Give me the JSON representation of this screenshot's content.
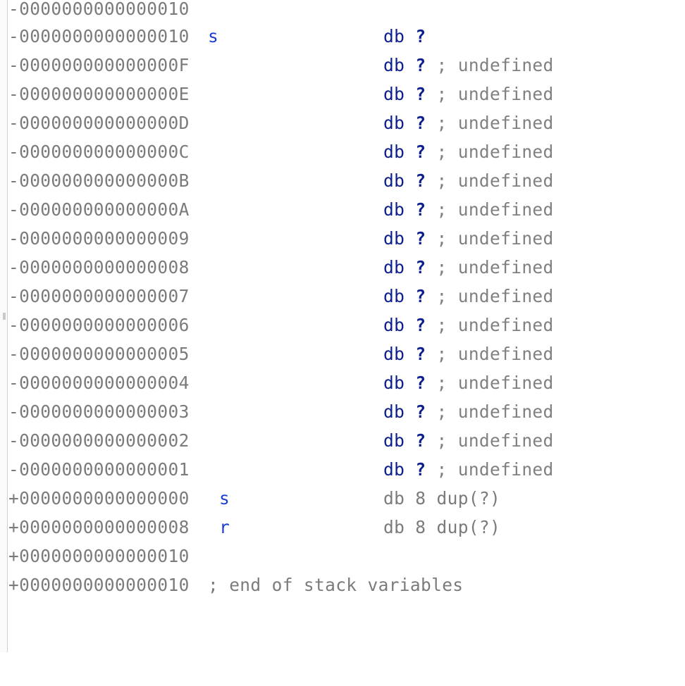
{
  "stack_frame": {
    "lines": [
      {
        "address": "-0000000000000010",
        "name": "",
        "directive": "",
        "operand": "",
        "comment": ""
      },
      {
        "address": "-0000000000000010",
        "name": "s",
        "directive": "db",
        "operand": "?",
        "comment": ""
      },
      {
        "address": "-000000000000000F",
        "name": "",
        "directive": "db",
        "operand": "?",
        "comment": "; undefined"
      },
      {
        "address": "-000000000000000E",
        "name": "",
        "directive": "db",
        "operand": "?",
        "comment": "; undefined"
      },
      {
        "address": "-000000000000000D",
        "name": "",
        "directive": "db",
        "operand": "?",
        "comment": "; undefined"
      },
      {
        "address": "-000000000000000C",
        "name": "",
        "directive": "db",
        "operand": "?",
        "comment": "; undefined"
      },
      {
        "address": "-000000000000000B",
        "name": "",
        "directive": "db",
        "operand": "?",
        "comment": "; undefined"
      },
      {
        "address": "-000000000000000A",
        "name": "",
        "directive": "db",
        "operand": "?",
        "comment": "; undefined"
      },
      {
        "address": "-0000000000000009",
        "name": "",
        "directive": "db",
        "operand": "?",
        "comment": "; undefined"
      },
      {
        "address": "-0000000000000008",
        "name": "",
        "directive": "db",
        "operand": "?",
        "comment": "; undefined"
      },
      {
        "address": "-0000000000000007",
        "name": "",
        "directive": "db",
        "operand": "?",
        "comment": "; undefined"
      },
      {
        "address": "-0000000000000006",
        "name": "",
        "directive": "db",
        "operand": "?",
        "comment": "; undefined"
      },
      {
        "address": "-0000000000000005",
        "name": "",
        "directive": "db",
        "operand": "?",
        "comment": "; undefined"
      },
      {
        "address": "-0000000000000004",
        "name": "",
        "directive": "db",
        "operand": "?",
        "comment": "; undefined"
      },
      {
        "address": "-0000000000000003",
        "name": "",
        "directive": "db",
        "operand": "?",
        "comment": "; undefined"
      },
      {
        "address": "-0000000000000002",
        "name": "",
        "directive": "db",
        "operand": "?",
        "comment": "; undefined"
      },
      {
        "address": "-0000000000000001",
        "name": "",
        "directive": "db",
        "operand": "?",
        "comment": "; undefined"
      },
      {
        "address": "+0000000000000000",
        "name": "s",
        "directive": "db 8 dup(?)",
        "operand": "",
        "comment": ""
      },
      {
        "address": "+0000000000000008",
        "name": "r",
        "directive": "db 8 dup(?)",
        "operand": "",
        "comment": ""
      },
      {
        "address": "+0000000000000010",
        "name": "",
        "directive": "",
        "operand": "",
        "comment": ""
      },
      {
        "address": "+0000000000000010",
        "name": "",
        "directive": "",
        "operand": "",
        "comment": "; end of stack variables"
      }
    ]
  },
  "colors": {
    "address": "#7b7b7b",
    "name": "#1d3fd0",
    "directive": "#0c1f8c",
    "comment": "#808080",
    "gutter_border": "#cfcfcf"
  }
}
